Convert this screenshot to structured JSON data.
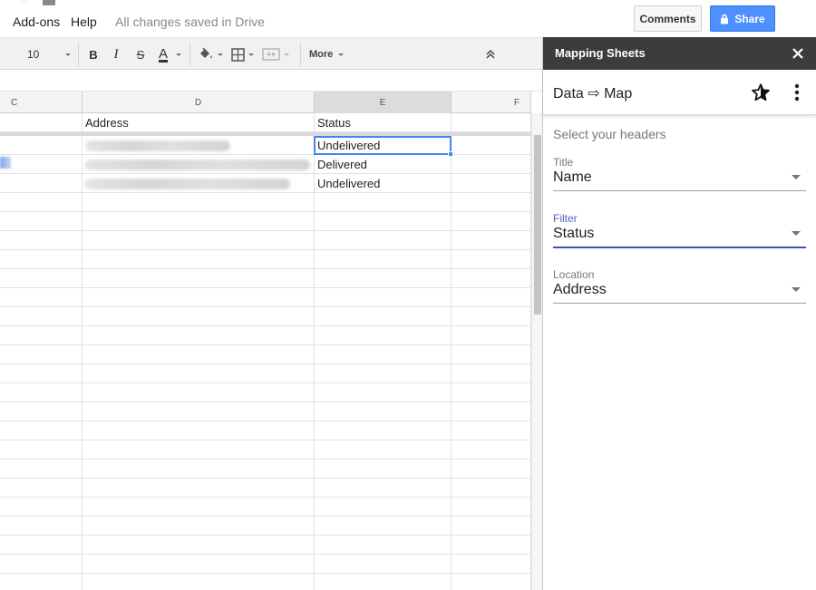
{
  "menubar": {
    "menus": [
      "Add-ons",
      "Help"
    ],
    "save_status": "All changes saved in Drive",
    "comments_label": "Comments",
    "share_label": "Share"
  },
  "toolbar": {
    "font_size": "10",
    "bold_label": "B",
    "italic_label": "I",
    "strike_label": "S",
    "text_color_label": "A",
    "more_label": "More",
    "text_color": "#000000"
  },
  "sheet": {
    "columns": [
      "C",
      "D",
      "E",
      "F"
    ],
    "header_row": [
      "",
      "Address",
      "Status",
      ""
    ],
    "rows": [
      [
        "",
        "",
        "Undelivered",
        ""
      ],
      [
        "",
        "",
        "Delivered",
        ""
      ],
      [
        "",
        "",
        "Undelivered",
        ""
      ]
    ],
    "selected_cell": "E"
  },
  "panel": {
    "title": "Mapping Sheets",
    "app_title": "Data ⇨ Map",
    "instructions": "Select your headers",
    "fields": [
      {
        "label": "Title",
        "value": "Name"
      },
      {
        "label": "Filter",
        "value": "Status"
      },
      {
        "label": "Location",
        "value": "Address"
      }
    ]
  },
  "colors": {
    "share_blue": "#4d90fe",
    "selection_blue": "#4285f4",
    "panel_header": "#3c3c3c",
    "focus_indigo": "#3f51b5"
  },
  "icons": [
    "star-icon",
    "folder-icon",
    "lock-icon",
    "paint-bucket-icon",
    "borders-icon",
    "merge-cells-icon",
    "chevron-up-double-icon",
    "close-icon",
    "star-plus-icon",
    "more-vert-icon"
  ]
}
